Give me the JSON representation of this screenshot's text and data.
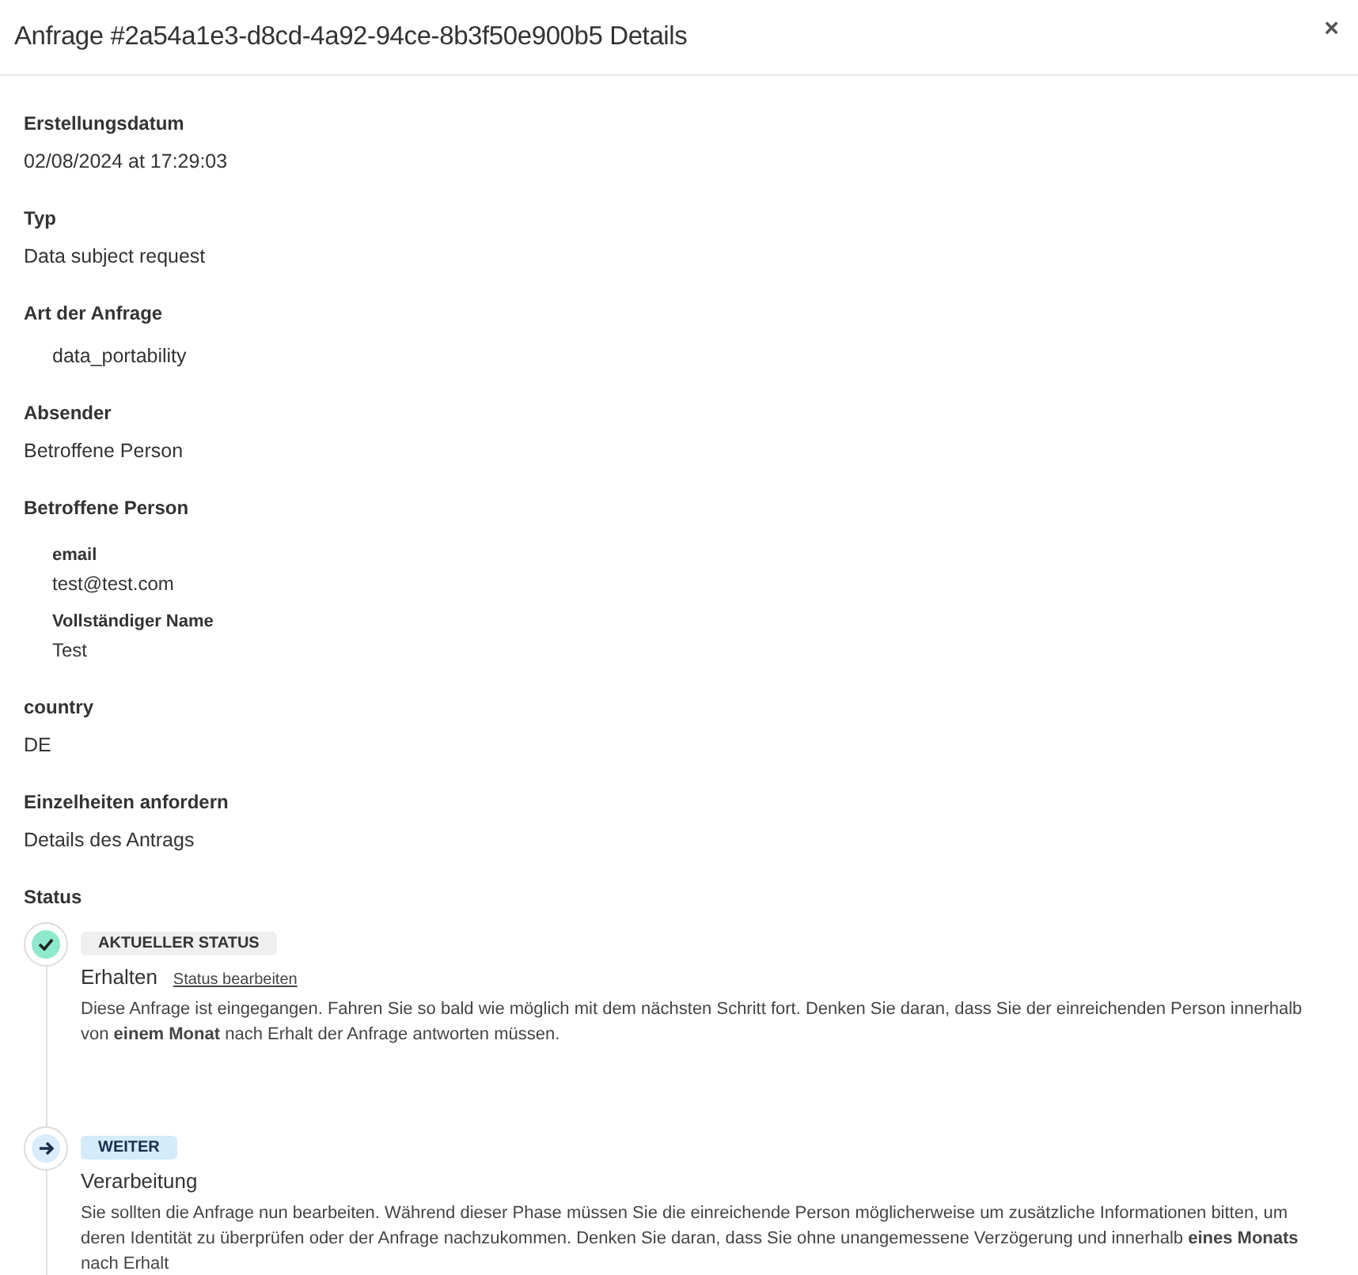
{
  "dialog": {
    "title": "Anfrage #2a54a1e3-d8cd-4a92-94ce-8b3f50e900b5 Details",
    "close": "×"
  },
  "fields": [
    {
      "kind": "plain",
      "label": "Erstellungsdatum",
      "value": "02/08/2024 at 17:29:03"
    },
    {
      "kind": "plain",
      "label": "Typ",
      "value": "Data subject request"
    },
    {
      "kind": "indented",
      "label": "Art der Anfrage",
      "value": "data_portability"
    },
    {
      "kind": "plain",
      "label": "Absender",
      "value": "Betroffene Person"
    },
    {
      "kind": "group",
      "label": "Betroffene Person",
      "children": [
        {
          "label": "email",
          "value": "test@test.com"
        },
        {
          "label": "Vollständiger Name",
          "value": "Test"
        }
      ]
    },
    {
      "kind": "plain",
      "label": "country",
      "value": "DE"
    },
    {
      "kind": "plain",
      "label": "Einzelheiten anfordern",
      "value": "Details des Antrags"
    }
  ],
  "status": {
    "label": "Status",
    "steps": [
      {
        "kind": "current",
        "badge": "AKTUELLER STATUS",
        "title": "Erhalten",
        "link": "Status bearbeiten",
        "text": "Diese Anfrage ist eingegangen. Fahren Sie so bald wie möglich mit dem nächsten Schritt fort. Denken Sie daran, dass Sie der einreichenden Person innerhalb von **einem Monat** nach Erhalt der Anfrage antworten müssen."
      },
      {
        "kind": "next",
        "badge": "WEITER",
        "title": "Verarbeitung",
        "text": "Sie sollten die Anfrage nun bearbeiten. Während dieser Phase müssen Sie die einreichende Person möglicherweise um zusätzliche Informationen bitten, um deren Identität zu überprüfen oder der Anfrage nachzukommen. Denken Sie daran, dass Sie ohne unangemessene Verzögerung und innerhalb **eines Monats** nach Erhalt"
      }
    ]
  }
}
